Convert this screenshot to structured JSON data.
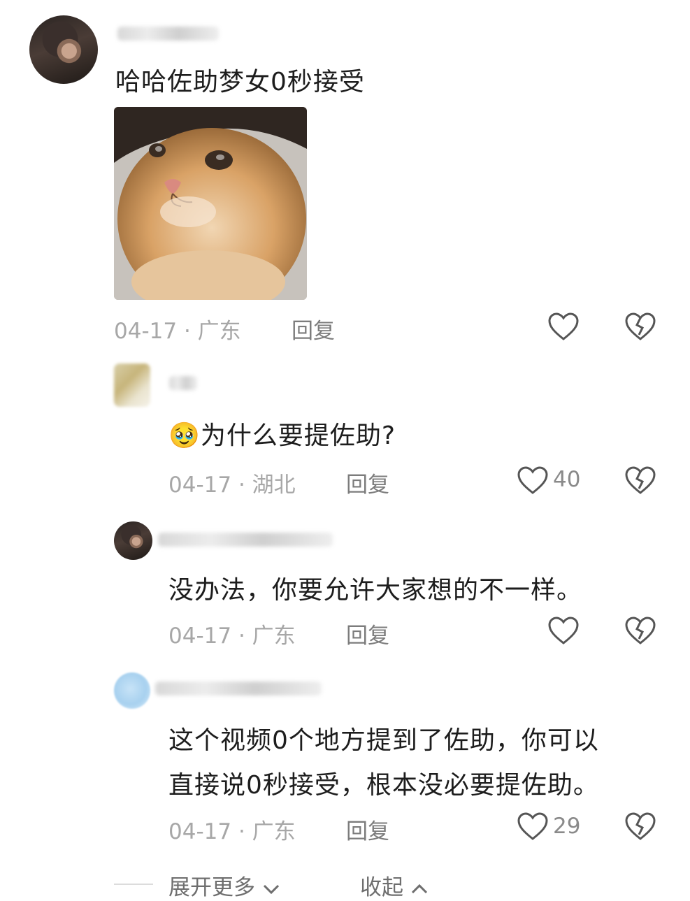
{
  "comments": [
    {
      "text": "哈哈佐助梦女0秒接受",
      "date": "04-17",
      "location": "广东",
      "reply_label": "回复",
      "likes": ""
    },
    {
      "emoji": "🥹",
      "text": "为什么要提佐助?",
      "date": "04-17",
      "location": "湖北",
      "reply_label": "回复",
      "likes": "40"
    },
    {
      "text": "没办法，你要允许大家想的不一样。",
      "date": "04-17",
      "location": "广东",
      "reply_label": "回复",
      "likes": ""
    },
    {
      "text_line1": "这个视频0个地方提到了佐助，你可以",
      "text_line2": "直接说0秒接受，根本没必要提佐助。",
      "date": "04-17",
      "location": "广东",
      "reply_label": "回复",
      "likes": "29"
    }
  ],
  "separator": "·",
  "footer": {
    "expand_label": "展开更多",
    "collapse_label": "收起"
  },
  "icons": {
    "like": "heart-outline-icon",
    "dislike": "broken-heart-icon",
    "expand": "chevron-down-icon",
    "collapse": "chevron-up-icon"
  }
}
